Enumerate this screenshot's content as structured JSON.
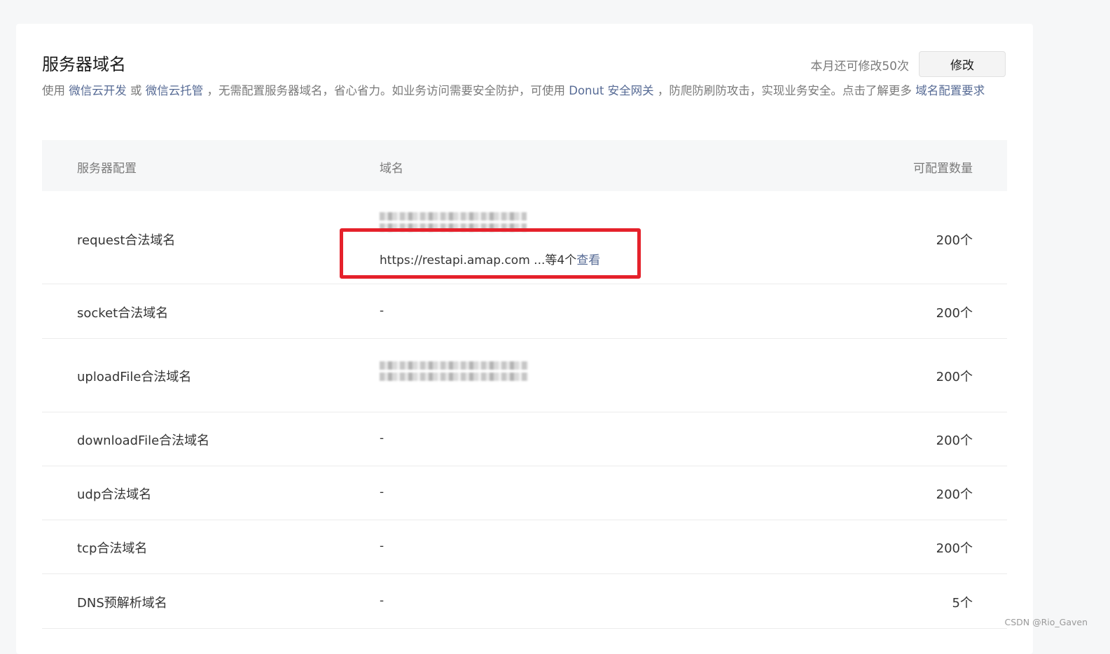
{
  "header": {
    "title": "服务器域名",
    "quota_text": "本月还可修改50次",
    "modify_label": "修改"
  },
  "description": {
    "part1": "使用 ",
    "link1": "微信云开发",
    "part2": " 或 ",
    "link2": "微信云托管",
    "part3": " ，无需配置服务器域名，省心省力。如业务访问需要安全防护，可使用 ",
    "link3": "Donut 安全网关",
    "part4": " ，防爬防刷防攻击，实现业务安全。点击了解更多 ",
    "link4": "域名配置要求"
  },
  "table": {
    "headers": {
      "config": "服务器配置",
      "domain": "域名",
      "count": "可配置数量"
    },
    "rows": [
      {
        "name": "request合法域名",
        "domain_text": "https://restapi.amap.com ...等4个",
        "view_label": "查看",
        "count": "200个"
      },
      {
        "name": "socket合法域名",
        "domain": "-",
        "count": "200个"
      },
      {
        "name": "uploadFile合法域名",
        "count": "200个"
      },
      {
        "name": "downloadFile合法域名",
        "domain": "-",
        "count": "200个"
      },
      {
        "name": "udp合法域名",
        "domain": "-",
        "count": "200个"
      },
      {
        "name": "tcp合法域名",
        "domain": "-",
        "count": "200个"
      },
      {
        "name": "DNS预解析域名",
        "domain": "-",
        "count": "5个"
      }
    ]
  },
  "annotation": {
    "box_color": "#e5212b"
  },
  "watermark": "CSDN @Rio_Gaven",
  "colors": {
    "link": "#576b95",
    "text": "#353535",
    "muted": "#7a7a7a"
  }
}
